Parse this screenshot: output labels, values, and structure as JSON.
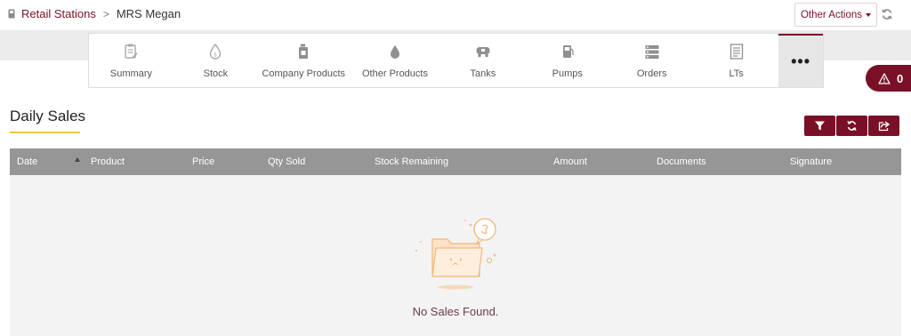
{
  "breadcrumb": {
    "parent": "Retail Stations",
    "separator": ">",
    "current": "MRS Megan"
  },
  "header": {
    "other_actions_label": "Other Actions"
  },
  "tabs": [
    {
      "label": "Summary",
      "icon": "summary-icon"
    },
    {
      "label": "Stock",
      "icon": "stock-icon"
    },
    {
      "label": "Company Products",
      "icon": "company-products-icon"
    },
    {
      "label": "Other Products",
      "icon": "other-products-icon"
    },
    {
      "label": "Tanks",
      "icon": "tanks-icon"
    },
    {
      "label": "Pumps",
      "icon": "pumps-icon"
    },
    {
      "label": "Orders",
      "icon": "orders-icon"
    },
    {
      "label": "LTs",
      "icon": "lts-icon"
    }
  ],
  "more_label": "•••",
  "alerts": {
    "count": "0"
  },
  "section": {
    "title": "Daily Sales"
  },
  "table": {
    "columns": [
      "Date",
      "Product",
      "Price",
      "Qty Sold",
      "Stock Remaining",
      "Amount",
      "Documents",
      "Signature"
    ],
    "rows": [],
    "empty_message": "No Sales Found."
  },
  "colors": {
    "brand": "#7a1027",
    "accent_underline": "#f2c44c",
    "table_header": "#969696"
  }
}
